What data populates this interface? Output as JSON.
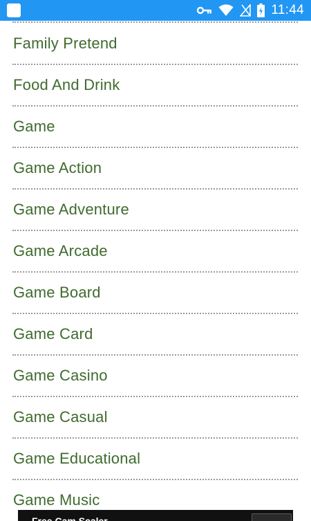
{
  "status_bar": {
    "time": "11:44",
    "icons": [
      "app-square-icon",
      "vpn-key-icon",
      "wifi-icon",
      "no-signal-icon",
      "battery-charging-icon"
    ],
    "background": "#2196f3"
  },
  "list": {
    "items": [
      {
        "label": "Family Pretend"
      },
      {
        "label": "Food And Drink"
      },
      {
        "label": "Game"
      },
      {
        "label": "Game Action"
      },
      {
        "label": "Game Adventure"
      },
      {
        "label": "Game Arcade"
      },
      {
        "label": "Game Board"
      },
      {
        "label": "Game Card"
      },
      {
        "label": "Game Casino"
      },
      {
        "label": "Game Casual"
      },
      {
        "label": "Game Educational"
      },
      {
        "label": "Game Music"
      }
    ],
    "text_color": "#3f6b2e",
    "separator_color": "#9a9a9a"
  },
  "ad_banner": {
    "text": "Free Cam Scaler"
  }
}
